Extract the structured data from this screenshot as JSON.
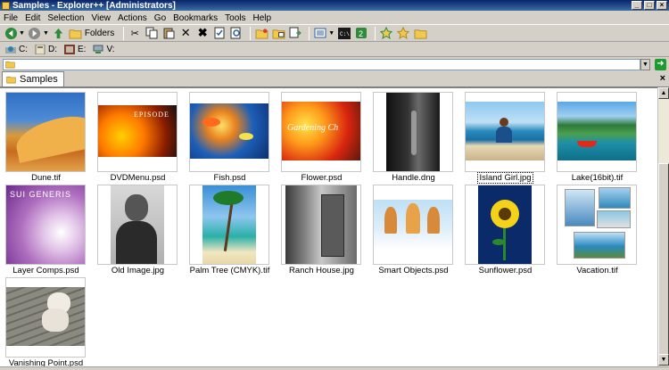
{
  "window": {
    "title": "Samples - Explorer++ [Administrators]"
  },
  "menu": [
    "File",
    "Edit",
    "Selection",
    "View",
    "Actions",
    "Go",
    "Bookmarks",
    "Tools",
    "Help"
  ],
  "toolbar": {
    "folders_label": "Folders"
  },
  "drives": [
    "C:",
    "D:",
    "E:",
    "V:"
  ],
  "address": {
    "value": ""
  },
  "tab": {
    "label": "Samples"
  },
  "files": [
    {
      "name": "Dune.tif"
    },
    {
      "name": "DVDMenu.psd"
    },
    {
      "name": "Fish.psd"
    },
    {
      "name": "Flower.psd"
    },
    {
      "name": "Handle.dng"
    },
    {
      "name": "Island Girl.jpg"
    },
    {
      "name": "Lake(16bit).tif"
    },
    {
      "name": "Layer Comps.psd"
    },
    {
      "name": "Old Image.jpg"
    },
    {
      "name": "Palm Tree (CMYK).tif"
    },
    {
      "name": "Ranch House.jpg"
    },
    {
      "name": "Smart Objects.psd"
    },
    {
      "name": "Sunflower.psd"
    },
    {
      "name": "Vacation.tif"
    },
    {
      "name": "Vanishing Point.psd"
    }
  ],
  "thumb_text": {
    "dvd": "EPISODE",
    "flower": "Gardening Ch",
    "layer": "SUI GENERIS"
  },
  "colors": {
    "title_start": "#0a246a",
    "title_end": "#3a6ea5",
    "selection_outline": "#000000"
  }
}
